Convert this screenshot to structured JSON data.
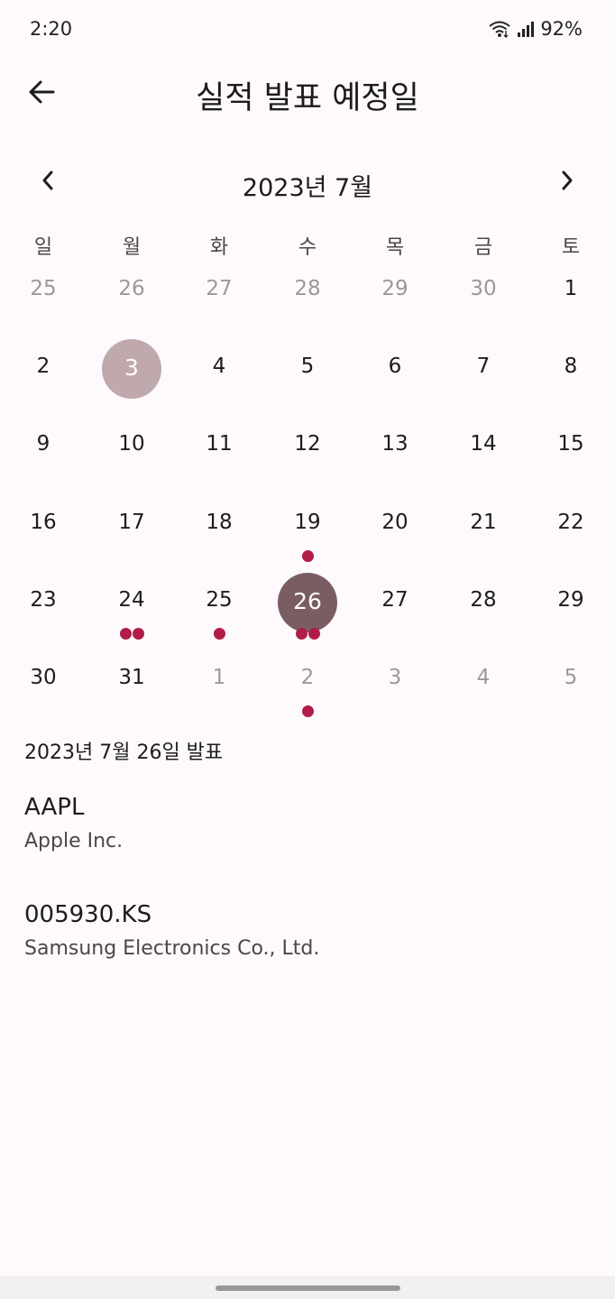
{
  "status": {
    "time": "2:20",
    "battery": "92%"
  },
  "header": {
    "title": "실적 발표 예정일"
  },
  "calendar": {
    "month_label": "2023년 7월",
    "weekdays": [
      "일",
      "월",
      "화",
      "수",
      "목",
      "금",
      "토"
    ],
    "weeks": [
      [
        {
          "d": "25",
          "out": true
        },
        {
          "d": "26",
          "out": true
        },
        {
          "d": "27",
          "out": true
        },
        {
          "d": "28",
          "out": true
        },
        {
          "d": "29",
          "out": true
        },
        {
          "d": "30",
          "out": true
        },
        {
          "d": "1"
        }
      ],
      [
        {
          "d": "2"
        },
        {
          "d": "3",
          "today": true
        },
        {
          "d": "4"
        },
        {
          "d": "5"
        },
        {
          "d": "6"
        },
        {
          "d": "7"
        },
        {
          "d": "8"
        }
      ],
      [
        {
          "d": "9"
        },
        {
          "d": "10"
        },
        {
          "d": "11"
        },
        {
          "d": "12"
        },
        {
          "d": "13"
        },
        {
          "d": "14"
        },
        {
          "d": "15"
        }
      ],
      [
        {
          "d": "16"
        },
        {
          "d": "17"
        },
        {
          "d": "18"
        },
        {
          "d": "19",
          "events": 1
        },
        {
          "d": "20"
        },
        {
          "d": "21"
        },
        {
          "d": "22"
        }
      ],
      [
        {
          "d": "23"
        },
        {
          "d": "24",
          "events": 2
        },
        {
          "d": "25",
          "events": 1
        },
        {
          "d": "26",
          "events": 2,
          "selected": true
        },
        {
          "d": "27"
        },
        {
          "d": "28"
        },
        {
          "d": "29"
        }
      ],
      [
        {
          "d": "30"
        },
        {
          "d": "31"
        },
        {
          "d": "1",
          "out": true
        },
        {
          "d": "2",
          "out": true,
          "events": 1
        },
        {
          "d": "3",
          "out": true
        },
        {
          "d": "4",
          "out": true
        },
        {
          "d": "5",
          "out": true
        }
      ]
    ],
    "colors": {
      "event_dot": "#b01d49",
      "selected": "#7a5d62",
      "today": "#bfa9ad"
    }
  },
  "selected_section": {
    "title": "2023년 7월 26일 발표",
    "items": [
      {
        "ticker": "AAPL",
        "name": "Apple Inc."
      },
      {
        "ticker": "005930.KS",
        "name": "Samsung Electronics Co., Ltd."
      }
    ]
  },
  "icons": {
    "back": "arrow-left-icon",
    "prev": "chevron-left-icon",
    "next": "chevron-right-icon",
    "wifi": "wifi-icon",
    "signal": "signal-icon"
  }
}
